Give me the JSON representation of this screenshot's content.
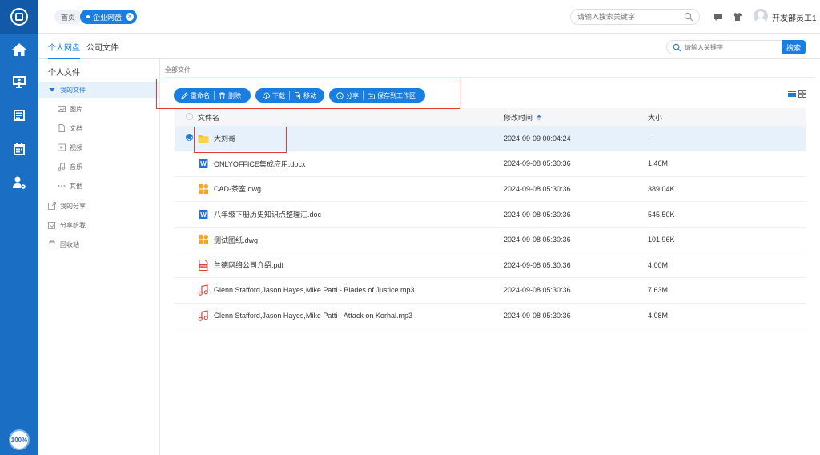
{
  "rail": {
    "zoom_label": "100%",
    "items": [
      "home-icon",
      "desktop-user-icon",
      "document-list-icon",
      "calendar-icon",
      "user-settings-icon"
    ]
  },
  "topbar": {
    "crumbs": {
      "home": "首页",
      "active": "企业网盘"
    },
    "search_placeholder": "请输入搜索关键字",
    "user_name": "开发部员工1"
  },
  "subbar": {
    "tabs": [
      {
        "label": "个人网盘",
        "active": true
      },
      {
        "label": "公司文件",
        "active": false
      }
    ],
    "search_placeholder": "请输入关键字",
    "search_button": "搜索"
  },
  "sidebar": {
    "title": "个人文件",
    "items": [
      {
        "label": "我的文件",
        "icon": "caret-down-icon",
        "selected": true
      },
      {
        "label": "图片",
        "icon": "image-icon"
      },
      {
        "label": "文档",
        "icon": "doc-icon"
      },
      {
        "label": "视频",
        "icon": "video-icon"
      },
      {
        "label": "音乐",
        "icon": "music-icon"
      },
      {
        "label": "其他",
        "icon": "more-icon"
      },
      {
        "label": "我的分享",
        "icon": "share-out-icon"
      },
      {
        "label": "分享给我",
        "icon": "share-in-icon"
      },
      {
        "label": "回收站",
        "icon": "trash-icon"
      }
    ]
  },
  "main": {
    "breadcrumb": "全部文件",
    "toolbar": {
      "rename": "重命名",
      "delete": "删除",
      "download": "下载",
      "move": "移动",
      "share": "分享",
      "save_to_workspace": "保存到工作区"
    },
    "table": {
      "headers": {
        "name": "文件名",
        "modified": "修改时间",
        "size": "大小"
      },
      "rows": [
        {
          "name": "大刘哥",
          "type": "folder",
          "modified": "2024-09-09 00:04:24",
          "size": "-",
          "selected": true
        },
        {
          "name": "ONLYOFFICE集成应用.docx",
          "type": "word",
          "modified": "2024-09-08 05:30:36",
          "size": "1.46M"
        },
        {
          "name": "CAD-茶室.dwg",
          "type": "cad",
          "modified": "2024-09-08 05:30:36",
          "size": "389.04K"
        },
        {
          "name": "八年级下册历史知识点整理汇.doc",
          "type": "word",
          "modified": "2024-09-08 05:30:36",
          "size": "545.50K"
        },
        {
          "name": "测试图纸.dwg",
          "type": "cad",
          "modified": "2024-09-08 05:30:36",
          "size": "101.96K"
        },
        {
          "name": "兰德网络公司介绍.pdf",
          "type": "pdf",
          "modified": "2024-09-08 05:30:36",
          "size": "4.00M"
        },
        {
          "name": "Glenn Stafford,Jason Hayes,Mike Patti - Blades of Justice.mp3",
          "type": "audio",
          "modified": "2024-09-08 05:30:36",
          "size": "7.63M"
        },
        {
          "name": "Glenn Stafford,Jason Hayes,Mike Patti - Attack on Korhal.mp3",
          "type": "audio",
          "modified": "2024-09-08 05:30:36",
          "size": "4.08M"
        }
      ]
    }
  },
  "colors": {
    "brand": "#1a7ee0",
    "rail": "#1a6fc4",
    "highlight": "#e53935",
    "selected_row": "#e7f1fc"
  }
}
